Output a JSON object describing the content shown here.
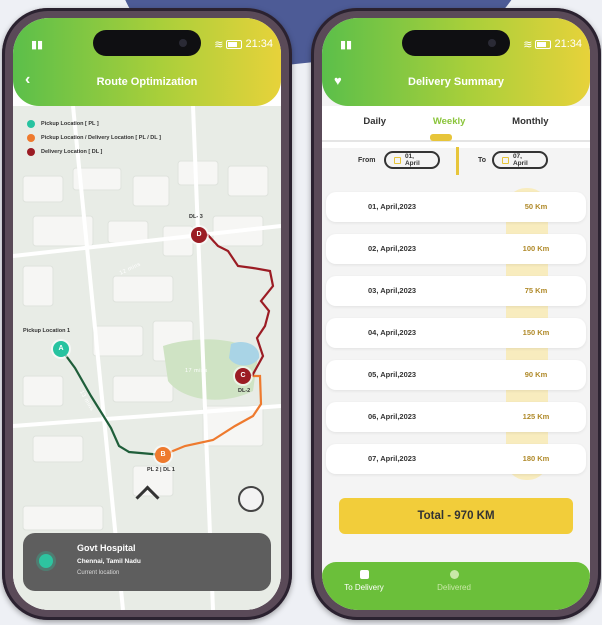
{
  "status_bar": {
    "time": "21:34"
  },
  "route_screen": {
    "title": "Route Optimization",
    "legend": [
      {
        "label": "Pickup Location [ PL ]",
        "color": "#27c3a0"
      },
      {
        "label": "Pickup Location / Delivery Location [ PL / DL ]",
        "color": "#ee7a2e"
      },
      {
        "label": "Delivery Location [ DL ]",
        "color": "#9b1c24"
      }
    ],
    "markers": {
      "a": {
        "letter": "A",
        "label": "Pickup Location 1"
      },
      "b": {
        "letter": "B",
        "label": "PL 2  |  DL 1"
      },
      "c": {
        "letter": "C",
        "label": "DL-2"
      },
      "d": {
        "letter": "D",
        "label": "DL- 3"
      }
    },
    "eta_labels": [
      "12 mins",
      "17 mins",
      "13 mins"
    ],
    "location_card": {
      "name": "Govt Hospital",
      "city": "Chennai, Tamil Nadu",
      "subtitle": "Current location"
    }
  },
  "summary_screen": {
    "title": "Delivery Summary",
    "tabs": [
      "Daily",
      "Weekly",
      "Monthly"
    ],
    "active_tab": "Weekly",
    "filter": {
      "from_label": "From",
      "from_value": "01, April",
      "to_label": "To",
      "to_value": "07, April"
    },
    "rows": [
      {
        "date": "01, April,2023",
        "km": "50 Km"
      },
      {
        "date": "02, April,2023",
        "km": "100 Km"
      },
      {
        "date": "03, April,2023",
        "km": "75 Km"
      },
      {
        "date": "04, April,2023",
        "km": "150 Km"
      },
      {
        "date": "05, April,2023",
        "km": "90 Km"
      },
      {
        "date": "06, April,2023",
        "km": "125 Km"
      },
      {
        "date": "07, April,2023",
        "km": "180 Km"
      }
    ],
    "total": "Total  - 970 KM",
    "nav": [
      {
        "label": "To Delivery",
        "active": true
      },
      {
        "label": "Delivered",
        "active": false
      }
    ]
  },
  "colors": {
    "accent_green": "#6bbf3a",
    "accent_yellow": "#f2cd3a",
    "route_green": "#1f5e3a",
    "route_orange": "#ee7a2e",
    "route_red": "#9b1c24"
  }
}
